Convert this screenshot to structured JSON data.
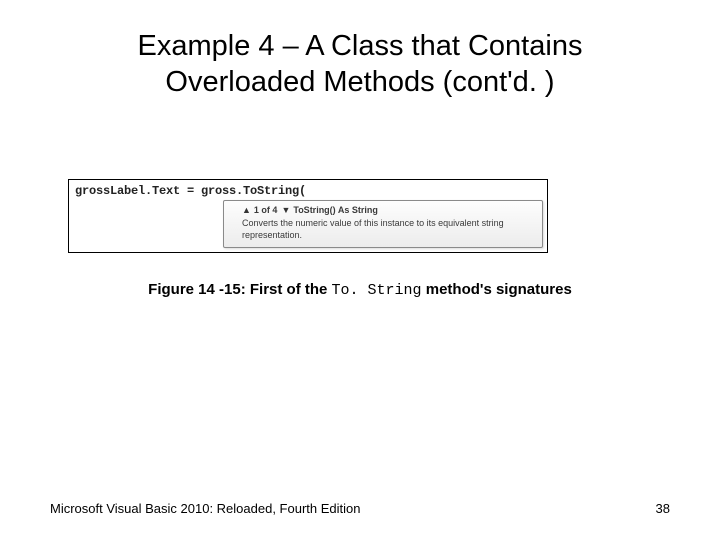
{
  "title_line1": "Example 4 – A Class that Contains",
  "title_line2": "Overloaded Methods (cont'd. )",
  "code_line": "grossLabel.Text = gross.ToString(",
  "tooltip": {
    "index": "1 of 4",
    "signature": "ToString() As String",
    "description": "Converts the numeric value of this instance to its equivalent string representation."
  },
  "caption_prefix": "Figure 14 -15: First of the ",
  "caption_mono": "To. String",
  "caption_suffix": " method's signatures",
  "footer_left": "Microsoft Visual Basic 2010: Reloaded, Fourth Edition",
  "footer_right": "38"
}
